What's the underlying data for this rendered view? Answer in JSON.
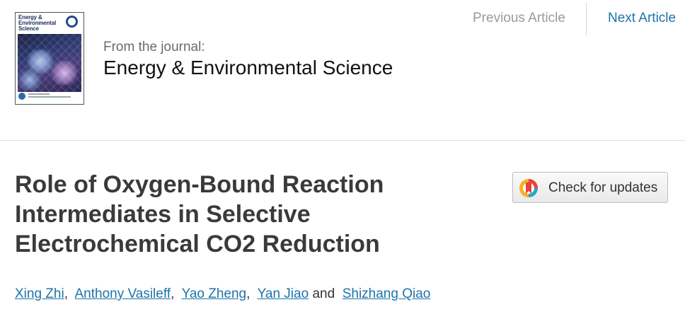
{
  "journal": {
    "cover_title": "Energy & Environmental Science",
    "from_label": "From the journal:",
    "name": "Energy & Environmental Science"
  },
  "nav": {
    "previous": "Previous Article",
    "next": "Next Article"
  },
  "article": {
    "title": "Role of Oxygen-Bound Reaction Intermediates in Selective Electrochemical CO2 Reduction",
    "check_updates": "Check for updates",
    "authors": [
      "Xing Zhi",
      "Anthony Vasileff",
      "Yao Zheng",
      "Yan Jiao",
      "Shizhang Qiao"
    ],
    "author_separator": ",",
    "author_conjunction": "and"
  },
  "colors": {
    "link": "#1e73a8",
    "muted_link": "#9a9a9a",
    "title_text": "#3a3a3a"
  },
  "icons": {
    "check_updates": "crossmark-icon"
  }
}
